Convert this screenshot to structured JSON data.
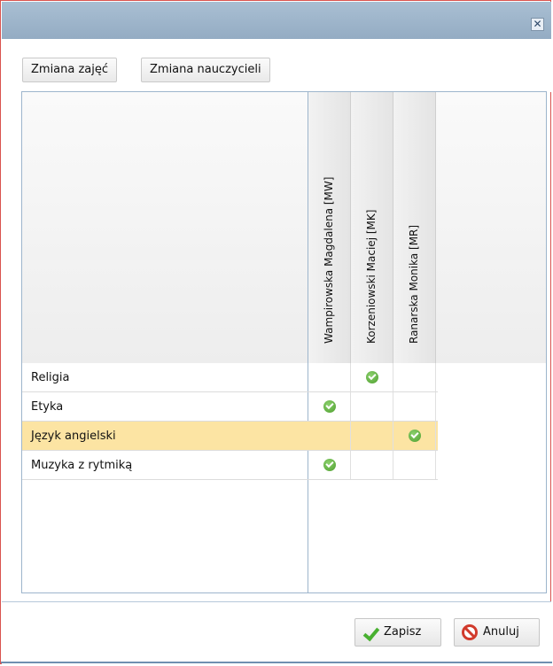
{
  "window": {
    "close_glyph": "✕"
  },
  "toolbar": {
    "btn_subjects": "Zmiana zajęć",
    "btn_teachers": "Zmiana nauczycieli"
  },
  "grid": {
    "teachers": [
      "Wampirowska Magdalena [MW]",
      "Korzeniowski Maciej [MK]",
      "Ranarska Monika [MR]"
    ],
    "rows": [
      {
        "subject": "Religia",
        "checks": [
          false,
          true,
          false
        ],
        "highlighted": false
      },
      {
        "subject": "Etyka",
        "checks": [
          true,
          false,
          false
        ],
        "highlighted": false
      },
      {
        "subject": "Język angielski",
        "checks": [
          false,
          false,
          true
        ],
        "highlighted": true
      },
      {
        "subject": "Muzyka z rytmiką",
        "checks": [
          true,
          false,
          false
        ],
        "highlighted": false
      }
    ]
  },
  "footer": {
    "save_label": "Zapisz",
    "cancel_label": "Anuluj"
  },
  "colors": {
    "highlight": "#fce4a3",
    "check": "#5aab38",
    "titlebar": "#a4bace"
  }
}
